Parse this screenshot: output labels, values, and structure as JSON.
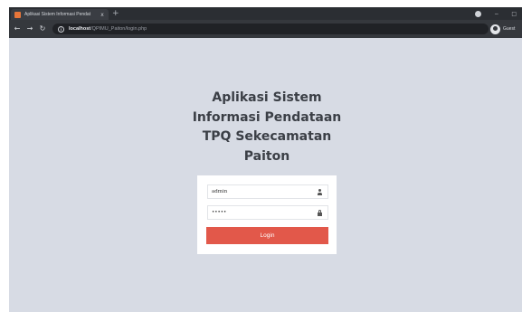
{
  "browser": {
    "tab_title": "Aplikasi Sistem Informasi Pendat",
    "tab_close": "x",
    "new_tab": "+",
    "url_host": "localhost",
    "url_path": "/QPIMU_Paiton/login.php",
    "profile_label": "Guest",
    "window_controls": {
      "minimize": "−",
      "maximize": "□"
    }
  },
  "page": {
    "title_lines": [
      "Aplikasi Sistem",
      "Informasi Pendataan",
      "TPQ Sekecamatan",
      "Paiton"
    ]
  },
  "login": {
    "username_value": "admin",
    "password_value": "•••••",
    "submit_label": "Login"
  },
  "colors": {
    "page_bg": "#d7dbe4",
    "button": "#e2584a",
    "title_text": "#3b3f46"
  }
}
